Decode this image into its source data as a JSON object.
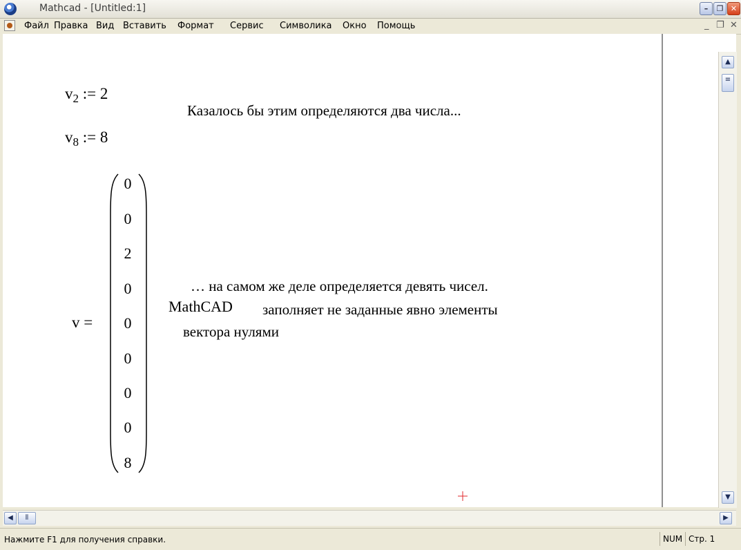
{
  "window": {
    "title": "Mathcad - [Untitled:1]"
  },
  "menu": {
    "items": [
      "Файл",
      "Правка",
      "Вид",
      "Вставить",
      "Формат",
      "Сервис",
      "Символика",
      "Окно",
      "Помощь"
    ]
  },
  "worksheet": {
    "def1": {
      "name": "v",
      "index": "2",
      "op": ":=",
      "value": "2"
    },
    "def2": {
      "name": "v",
      "index": "8",
      "op": ":=",
      "value": "8"
    },
    "eval": {
      "name": "v",
      "op": "="
    },
    "vector": [
      "0",
      "0",
      "2",
      "0",
      "0",
      "0",
      "0",
      "0",
      "8"
    ],
    "text1": "Казалось бы этим определяются два числа...",
    "text2": {
      "line1": "… на самом же деле определяется девять чисел.",
      "prefix": "MathCAD",
      "line2": "заполняет не заданные явно элементы",
      "line3": "вектора нулями"
    }
  },
  "status": {
    "help": "Нажмите F1 для получения справки.",
    "num": "NUM",
    "page": "Стр. 1"
  },
  "colors": {
    "cursor": "#e2272b",
    "scroll_button": "#c7d4ee"
  }
}
